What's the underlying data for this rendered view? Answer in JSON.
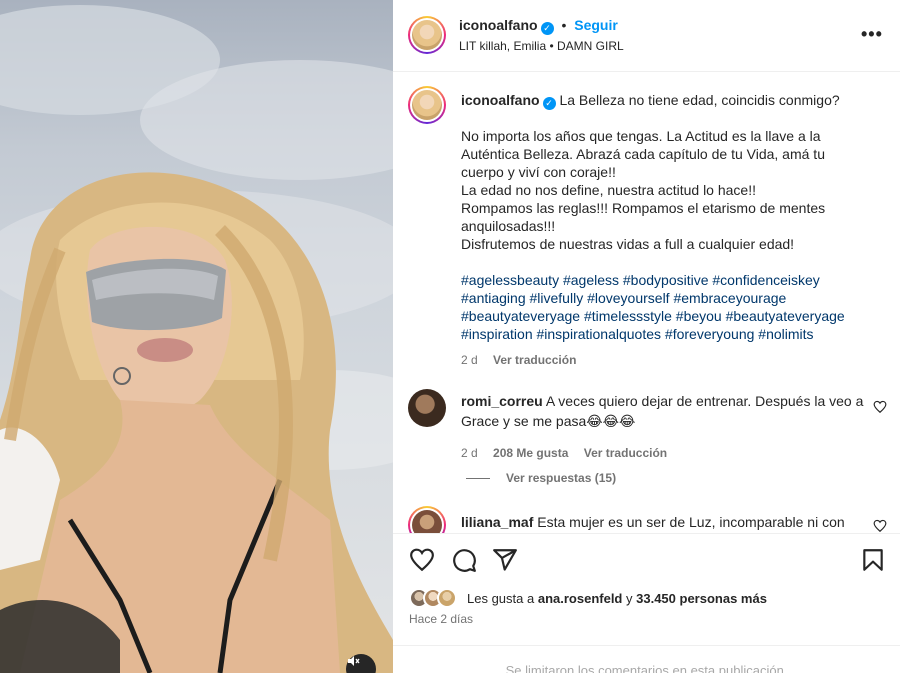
{
  "post": {
    "author": "iconoalfano",
    "follow_label": "Seguir",
    "separator": "•",
    "audio": "LIT killah, Emilia • DAMN GIRL",
    "more_label": "•••"
  },
  "caption": {
    "author": "iconoalfano",
    "title": "La Belleza no tiene edad, coincidis conmigo?",
    "body_1": "No importa los años que tengas. La Actitud es la llave a la Auténtica Belleza. Abrazá cada capítulo de tu Vida, amá tu cuerpo y viví con coraje!!",
    "body_2": "La edad no nos define, nuestra actitud lo hace!!",
    "body_3": "Rompamos las reglas!!! Rompamos el etarismo de mentes anquilosadas!!!",
    "body_4": "Disfrutemos de nuestras vidas a full a cualquier edad!",
    "hashtags": "#agelessbeauty #ageless #bodypositive #confidenceiskey #antiaging #livefully #loveyourself #embraceyourage #beautyateveryage #timelessstyle #beyou #beautyateveryage #inspiration #inspirationalquotes #foreveryoung #nolimits",
    "age": "2 d",
    "translate": "Ver traducción"
  },
  "comments": [
    {
      "user": "romi_correu",
      "text": "A veces quiero dejar de entrenar. Después la veo a Grace y se me pasa😂😂😂",
      "age": "2 d",
      "likes": "208 Me gusta",
      "translate": "Ver traducción"
    },
    {
      "user": "liliana_maf",
      "text": "Esta mujer es un ser de Luz, incomparable ni con"
    }
  ],
  "view_replies": "Ver respuestas (15)",
  "likes": {
    "prefix": "Les gusta a",
    "user": "ana.rosenfeld",
    "conj": "y",
    "others": "33.450 personas más"
  },
  "time_ago": "Hace 2 días",
  "footer_note": "Se limitaron los comentarios en esta publicación.",
  "icons": [
    "heart-icon",
    "comment-icon",
    "share-icon",
    "bookmark-icon",
    "mute-icon",
    "more-icon",
    "verified-icon"
  ],
  "colors": {
    "accent": "#0095f6",
    "hashtag": "#00376b",
    "muted": "#737373"
  }
}
